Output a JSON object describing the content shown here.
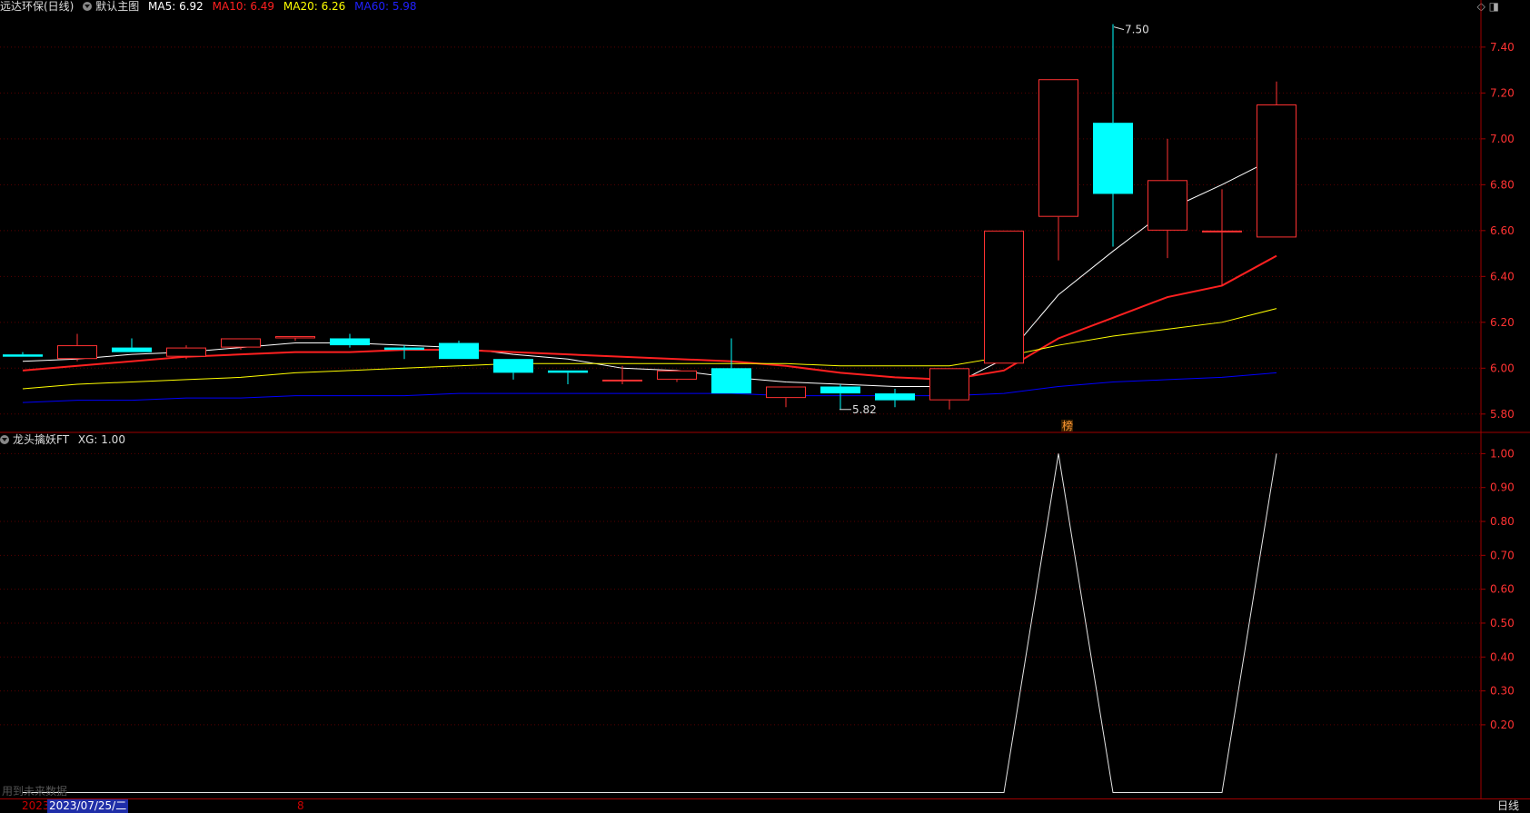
{
  "header": {
    "stock": "远达环保(日线)",
    "chart_name": "默认主图",
    "ma5": "MA5: 6.92",
    "ma10": "MA10: 6.49",
    "ma20": "MA20: 6.26",
    "ma60": "MA60: 5.98",
    "icons": [
      "diamond-icon",
      "panel-toggle-icon"
    ]
  },
  "sub_header": {
    "indicator": "龙头擒妖FT",
    "xg": "XG: 1.00"
  },
  "footer": {
    "year": "2023",
    "cursor_date": "2023/07/25/二",
    "month": "8",
    "period": "日线",
    "future_note": "用到未来数据"
  },
  "colors": {
    "up": "#ff3232",
    "down": "#00ffff",
    "ma5": "#ffffff",
    "ma10": "#ff2020",
    "ma20": "#ffff00",
    "ma60": "#0000ff",
    "axis": "#a00000",
    "grid": "#5a0000"
  },
  "chart_data": [
    {
      "type": "candlestick",
      "ylim": [
        5.72,
        7.55
      ],
      "y_ticks": [
        "7.40",
        "7.20",
        "7.00",
        "6.80",
        "6.60",
        "6.40",
        "6.20",
        "6.00",
        "5.80"
      ],
      "y_tick_values": [
        7.4,
        7.2,
        7.0,
        6.8,
        6.6,
        6.4,
        6.2,
        6.0,
        5.8
      ],
      "annotations": {
        "high_label": "7.50",
        "low_label": "5.82",
        "marker": "榜"
      },
      "candles": [
        {
          "o": 6.06,
          "h": 6.07,
          "l": 6.05,
          "c": 6.05
        },
        {
          "o": 6.04,
          "h": 6.15,
          "l": 6.03,
          "c": 6.1
        },
        {
          "o": 6.09,
          "h": 6.13,
          "l": 6.07,
          "c": 6.07
        },
        {
          "o": 6.05,
          "h": 6.1,
          "l": 6.04,
          "c": 6.09
        },
        {
          "o": 6.09,
          "h": 6.13,
          "l": 6.08,
          "c": 6.13
        },
        {
          "o": 6.13,
          "h": 6.14,
          "l": 6.12,
          "c": 6.14
        },
        {
          "o": 6.13,
          "h": 6.15,
          "l": 6.09,
          "c": 6.1
        },
        {
          "o": 6.09,
          "h": 6.1,
          "l": 6.04,
          "c": 6.08
        },
        {
          "o": 6.11,
          "h": 6.12,
          "l": 6.04,
          "c": 6.04
        },
        {
          "o": 6.04,
          "h": 6.04,
          "l": 5.95,
          "c": 5.98
        },
        {
          "o": 5.99,
          "h": 5.99,
          "l": 5.93,
          "c": 5.98
        },
        {
          "o": 5.95,
          "h": 6.01,
          "l": 5.93,
          "c": 5.95
        },
        {
          "o": 5.95,
          "h": 5.99,
          "l": 5.94,
          "c": 5.99
        },
        {
          "o": 6.0,
          "h": 6.13,
          "l": 5.89,
          "c": 5.89
        },
        {
          "o": 5.87,
          "h": 5.92,
          "l": 5.83,
          "c": 5.92
        },
        {
          "o": 5.92,
          "h": 5.93,
          "l": 5.82,
          "c": 5.89
        },
        {
          "o": 5.89,
          "h": 5.91,
          "l": 5.83,
          "c": 5.86
        },
        {
          "o": 5.86,
          "h": 6.0,
          "l": 5.82,
          "c": 6.0
        },
        {
          "o": 6.02,
          "h": 6.6,
          "l": 6.02,
          "c": 6.6
        },
        {
          "o": 6.66,
          "h": 7.26,
          "l": 6.47,
          "c": 7.26
        },
        {
          "o": 7.07,
          "h": 7.5,
          "l": 6.53,
          "c": 6.76
        },
        {
          "o": 6.6,
          "h": 7.0,
          "l": 6.48,
          "c": 6.82
        },
        {
          "o": 6.6,
          "h": 6.78,
          "l": 6.36,
          "c": 6.6
        },
        {
          "o": 6.57,
          "h": 7.25,
          "l": 6.57,
          "c": 7.15
        }
      ],
      "series": [
        {
          "name": "MA5",
          "values": [
            6.03,
            6.04,
            6.06,
            6.07,
            6.09,
            6.11,
            6.11,
            6.1,
            6.09,
            6.06,
            6.04,
            6.0,
            5.99,
            5.96,
            5.94,
            5.93,
            5.92,
            5.92,
            6.04,
            6.32,
            6.51,
            6.69,
            6.8,
            6.92
          ]
        },
        {
          "name": "MA10",
          "values": [
            5.99,
            6.01,
            6.03,
            6.05,
            6.06,
            6.07,
            6.07,
            6.08,
            6.08,
            6.07,
            6.06,
            6.05,
            6.04,
            6.03,
            6.01,
            5.98,
            5.96,
            5.95,
            5.99,
            6.13,
            6.22,
            6.31,
            6.36,
            6.49
          ]
        },
        {
          "name": "MA20",
          "values": [
            5.91,
            5.93,
            5.94,
            5.95,
            5.96,
            5.98,
            5.99,
            6.0,
            6.01,
            6.02,
            6.02,
            6.02,
            6.02,
            6.02,
            6.02,
            6.01,
            6.01,
            6.01,
            6.05,
            6.1,
            6.14,
            6.17,
            6.2,
            6.26
          ]
        },
        {
          "name": "MA60",
          "values": [
            5.85,
            5.86,
            5.86,
            5.87,
            5.87,
            5.88,
            5.88,
            5.88,
            5.89,
            5.89,
            5.89,
            5.89,
            5.89,
            5.89,
            5.88,
            5.88,
            5.88,
            5.88,
            5.89,
            5.92,
            5.94,
            5.95,
            5.96,
            5.98
          ]
        }
      ]
    },
    {
      "type": "line",
      "name": "XG",
      "ylim": [
        -0.02,
        1.06
      ],
      "y_ticks": [
        "1.00",
        "0.90",
        "0.80",
        "0.70",
        "0.60",
        "0.50",
        "0.40",
        "0.30",
        "0.20"
      ],
      "y_tick_values": [
        1.0,
        0.9,
        0.8,
        0.7,
        0.6,
        0.5,
        0.4,
        0.3,
        0.2
      ],
      "values": [
        0,
        0,
        0,
        0,
        0,
        0,
        0,
        0,
        0,
        0,
        0,
        0,
        0,
        0,
        0,
        0,
        0,
        0,
        0,
        1,
        0,
        0,
        0,
        1
      ]
    }
  ]
}
